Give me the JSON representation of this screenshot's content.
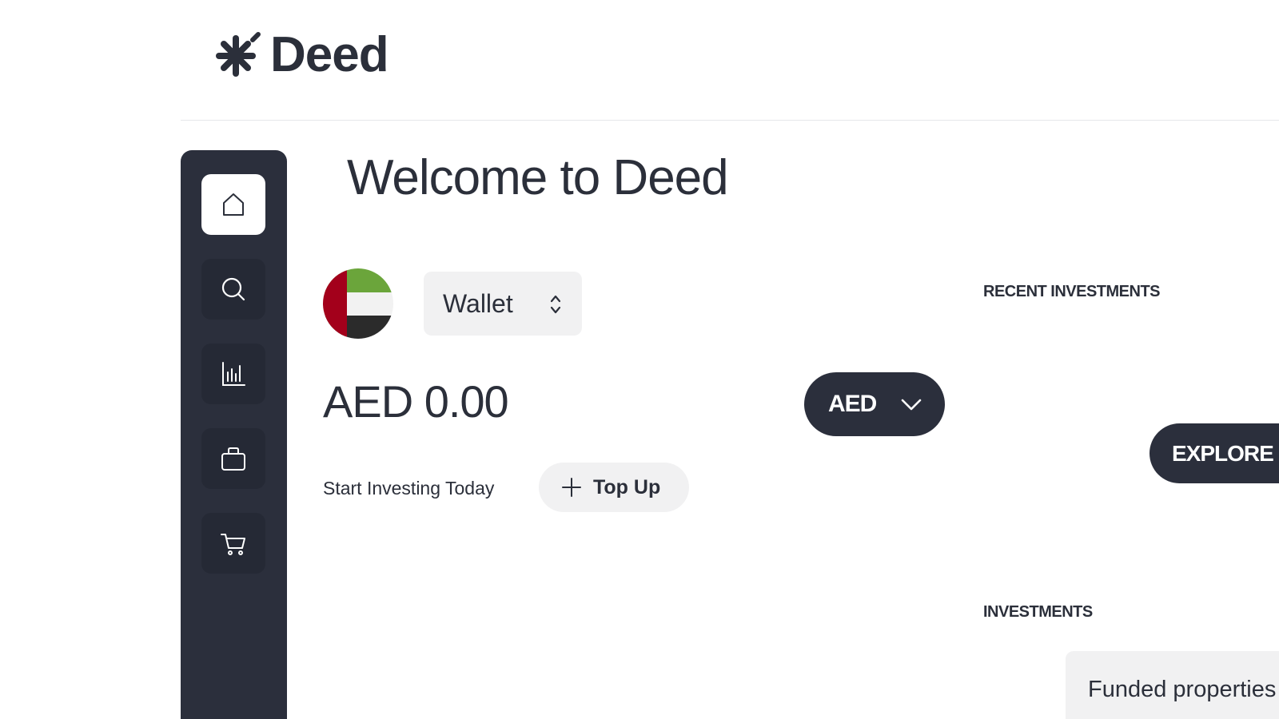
{
  "brand": {
    "name": "Deed",
    "logo_icon": "asterisk-logo-icon"
  },
  "sidebar": {
    "items": [
      {
        "id": "home",
        "icon": "home-icon",
        "active": true
      },
      {
        "id": "search",
        "icon": "search-icon",
        "active": false
      },
      {
        "id": "analytics",
        "icon": "chart-icon",
        "active": false
      },
      {
        "id": "portfolio",
        "icon": "briefcase-icon",
        "active": false
      },
      {
        "id": "cart",
        "icon": "cart-icon",
        "active": false
      }
    ]
  },
  "main": {
    "title": "Welcome to Deed",
    "wallet": {
      "flag_icon": "uae-flag-icon",
      "selector_label": "Wallet",
      "balance": "AED 0.00",
      "currency": "AED",
      "start_text": "Start Investing Today",
      "topup_label": "Top Up"
    }
  },
  "right_panel": {
    "recent_title": "RECENT INVESTMENTS",
    "explore_label": "EXPLORE",
    "investments_title": "INVESTMENTS",
    "funded_label": "Funded properties"
  },
  "colors": {
    "primary_dark": "#2b2f3c",
    "surface_light": "#f1f1f2",
    "flag_red": "#a3001b",
    "flag_green": "#6ba53b",
    "flag_black": "#2b2b2b"
  }
}
